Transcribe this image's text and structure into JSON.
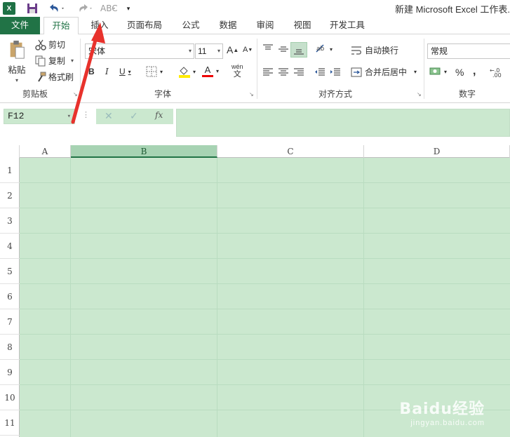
{
  "app": {
    "logo_text": "X",
    "title": "新建 Microsoft Excel 工作表."
  },
  "tabs": [
    "文件",
    "开始",
    "插入",
    "页面布局",
    "公式",
    "数据",
    "审阅",
    "视图",
    "开发工具"
  ],
  "ribbon": {
    "clipboard": {
      "paste": "粘贴",
      "cut": "剪切",
      "copy": "复制",
      "format_painter": "格式刷",
      "group_label": "剪贴板"
    },
    "font": {
      "name": "宋体",
      "size": "11",
      "grow": "A",
      "shrink": "A",
      "bold": "B",
      "italic": "I",
      "underline": "U",
      "font_color_letter": "A",
      "phonetic_top": "wén",
      "phonetic_bottom": "文",
      "group_label": "字体"
    },
    "alignment": {
      "wrap_text": "自动换行",
      "merge_center": "合并后居中",
      "group_label": "对齐方式"
    },
    "number": {
      "format": "常规",
      "percent": "%",
      "comma": ",",
      "group_label": "数字"
    }
  },
  "formula_bar": {
    "name_box": "F12",
    "fx": "fx",
    "content": ""
  },
  "sheet": {
    "columns": [
      "A",
      "B",
      "C",
      "D"
    ],
    "selected_column": "B",
    "rows": [
      "1",
      "2",
      "3",
      "4",
      "5",
      "6",
      "7",
      "8",
      "9",
      "10",
      "11"
    ]
  },
  "colors": {
    "excel_green": "#217346",
    "grid_fill": "#cbe8cf",
    "annotation_arrow": "#e8322c"
  },
  "watermark": {
    "logo": "Baidu经验",
    "url": "jingyan.baidu.com"
  }
}
